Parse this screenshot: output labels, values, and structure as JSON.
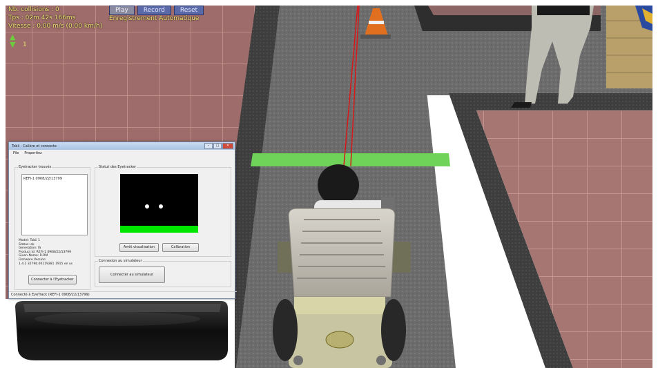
{
  "hud": {
    "collisions": "Nb. collisions : 0",
    "time": "Tps : 02m 42s 166ms",
    "speed": "Vitesse : 0.00 m/s (0.00 km/h)",
    "play_label": "Play",
    "record_label": "Record",
    "reset_label": "Reset",
    "auto_recording": "Enregistrement Automatique",
    "arrow_count": "1"
  },
  "tobii": {
    "window_title": "Tobii - Calibre et connecte",
    "minimize": "–",
    "maximize": "□",
    "close": "✕",
    "menu_file": "File",
    "menu_properties": "Propertiez",
    "eyetracker_group": "Eyetracker trouvés",
    "eyetracker_item": "REFI-1 0908/22/13799",
    "model": "Model: Tobii 1",
    "status": "Status: ok",
    "generation": "Generation: IS",
    "product_id": "Product Id: REFI-1 0908/22/13799",
    "given_name": "Given Name: R-RM",
    "firmware_label": "Firmware Version:",
    "firmware_value": "1.4.2 3279b.00119281 1915 en us",
    "connect_eyetracker": "Connecter à l'Eyetracker",
    "status_group": "Statut des Eyetracker",
    "stop_visualisation": "Arrêt visualisation",
    "calibration": "Calibration",
    "simulator_group": "Connexion au simulateur",
    "connect_simulator": "Connecter au simulateur",
    "status_bar": "Connecté à EyeTrack (REFI-1 0908/22/13799)"
  },
  "colors": {
    "hud_text": "#e8e070",
    "floor_tile": "#9a6a68",
    "asphalt": "#6a6a6a",
    "green_stripe": "#6fd35a",
    "track_green": "#00e600"
  }
}
